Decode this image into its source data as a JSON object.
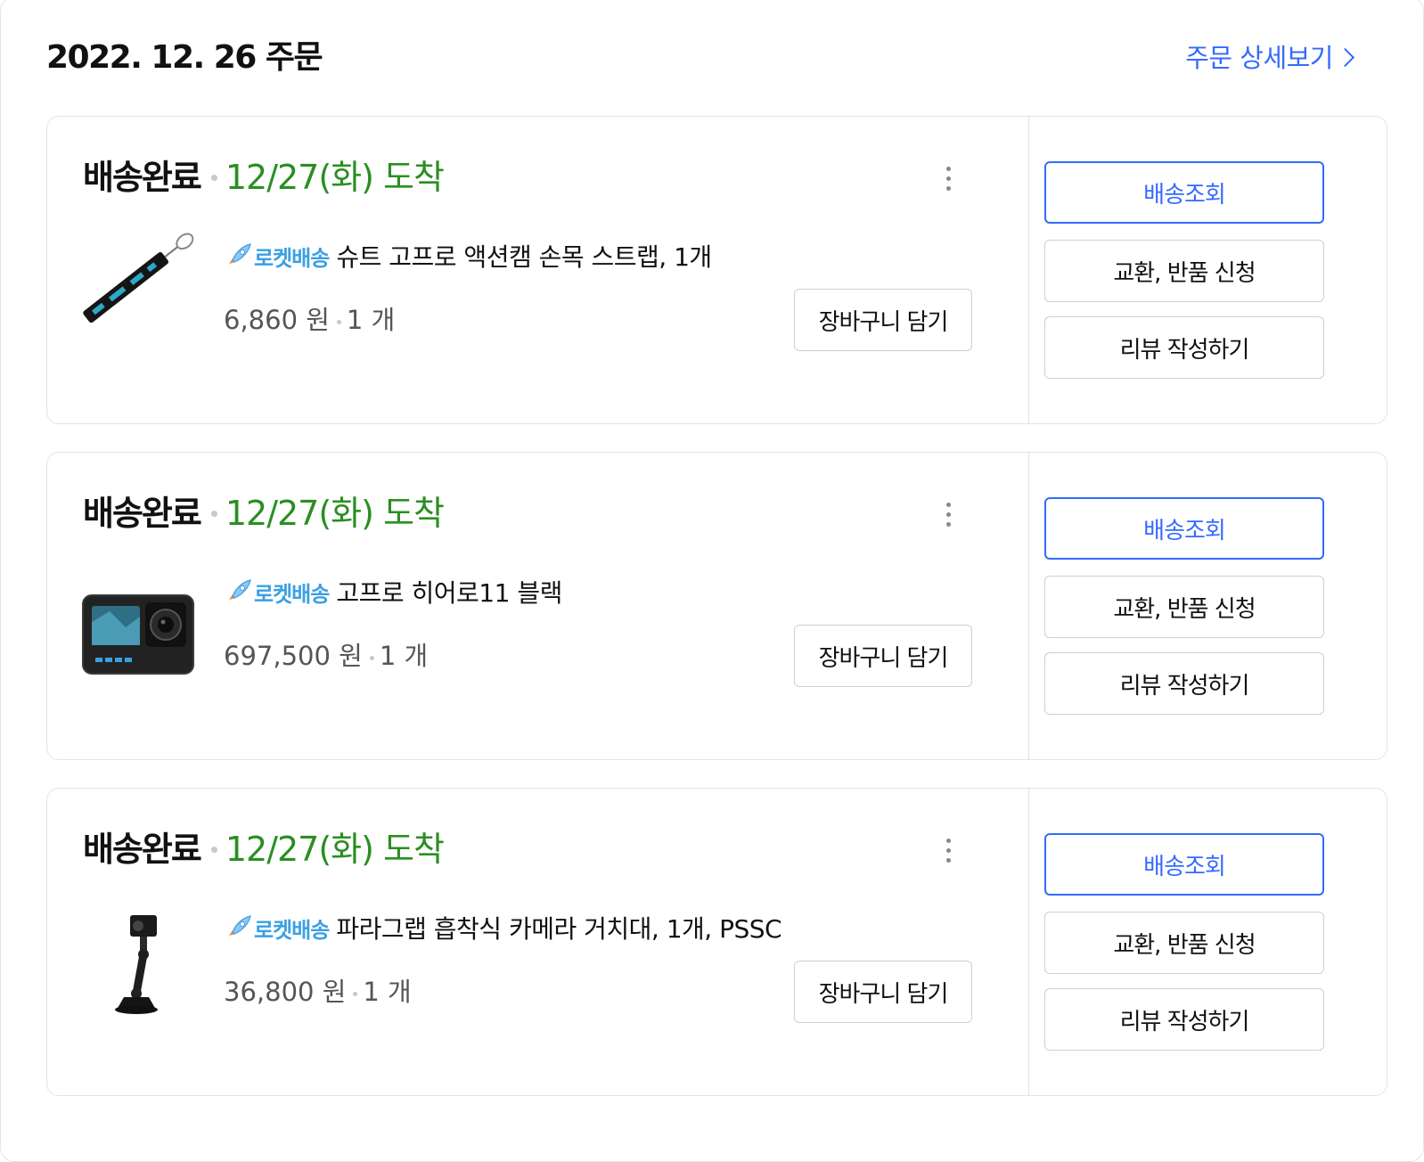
{
  "order": {
    "date_label": "2022. 12. 26 주문",
    "detail_link": "주문 상세보기"
  },
  "labels": {
    "rocket": "로켓배송",
    "more_menu": "more options",
    "add_to_cart": "장바구니 담기",
    "track_delivery": "배송조회",
    "exchange_return": "교환, 반품 신청",
    "write_review": "리뷰 작성하기"
  },
  "colors": {
    "accent_blue": "#346aff",
    "arrival_green": "#2a8f22",
    "rocket_blue": "#3aa0e4"
  },
  "shipments": [
    {
      "status": "배송완료",
      "arrival": "12/27(화) 도착",
      "product_name": "슈트 고프로 액션캠 손목 스트랩, 1개",
      "price": "6,860 원",
      "quantity": "1 개",
      "thumbnail_icon": "wrist-strap-image"
    },
    {
      "status": "배송완료",
      "arrival": "12/27(화) 도착",
      "product_name": "고프로 히어로11 블랙",
      "price": "697,500 원",
      "quantity": "1 개",
      "thumbnail_icon": "action-camera-image"
    },
    {
      "status": "배송완료",
      "arrival": "12/27(화) 도착",
      "product_name": "파라그랩 흡착식 카메라 거치대, 1개, PSSC",
      "price": "36,800 원",
      "quantity": "1 개",
      "thumbnail_icon": "suction-mount-image"
    }
  ]
}
